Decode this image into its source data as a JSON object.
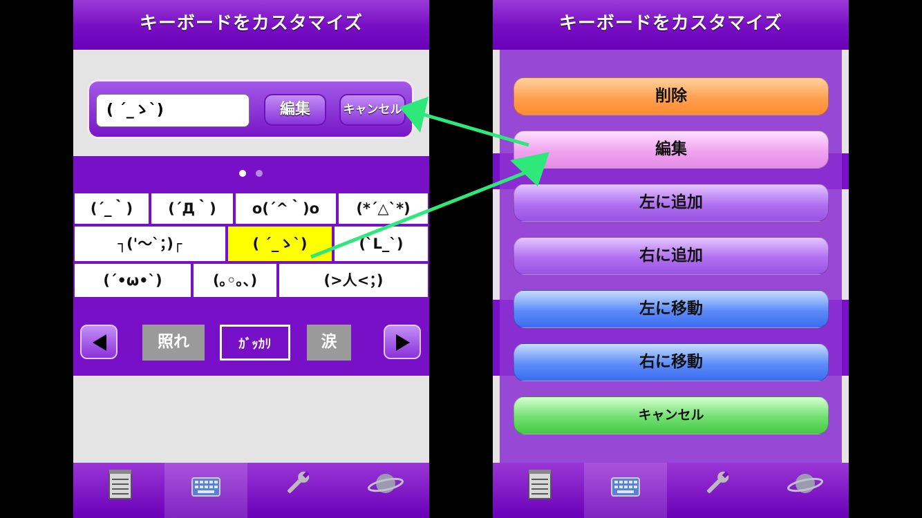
{
  "left_screen": {
    "title": "キーボードをカスタマイズ",
    "edit_input_value": "( ´_ゝ`)",
    "edit_button_label": "編集",
    "cancel_button_label": "キャンセル",
    "page_dots": [
      true,
      false
    ],
    "kaomoji_rows": [
      [
        "(´_｀)",
        "(´Д｀)",
        "o(´^｀)o",
        "(*´△`*)"
      ],
      [
        "┐('～`；)┌",
        "( ´_ゝ`)",
        "(`L_`)"
      ],
      [
        "(´•ω•`)",
        "(｡◦｡､)",
        "(>人<；)"
      ]
    ],
    "selected_kaomoji": "( ´_ゝ`)",
    "categories": [
      "照れ",
      "ｶﾞｯｶﾘ",
      "涙"
    ],
    "selected_category": "ｶﾞｯｶﾘ"
  },
  "right_screen": {
    "title": "キーボードをカスタマイズ",
    "actions": [
      "削除",
      "編集",
      "左に追加",
      "右に追加",
      "左に移動",
      "右に移動",
      "キャンセル"
    ]
  },
  "tabs": [
    "notepad-icon",
    "keyboard-icon",
    "wrench-icon",
    "planet-icon"
  ],
  "active_tab": "keyboard-icon",
  "colors": {
    "purple": "#7810c8",
    "selected_yellow": "#ffff00",
    "arrow_green": "#2ee87a"
  }
}
